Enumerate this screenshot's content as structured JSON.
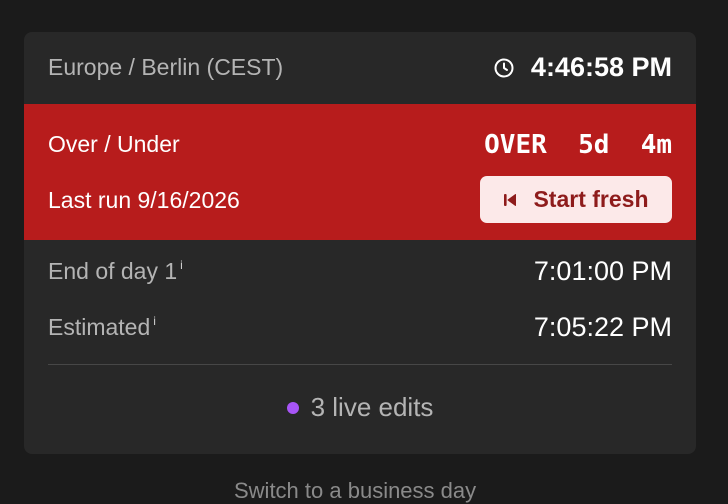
{
  "header": {
    "timezone": "Europe / Berlin (CEST)",
    "current_time": "4:46:58 PM",
    "clock_icon": "clock-icon"
  },
  "status": {
    "label": "Over / Under",
    "value": "OVER  5d  4m",
    "last_run": "Last run 9/16/2026",
    "start_button_label": "Start fresh",
    "start_button_icon": "skip-back-icon",
    "panel_color": "#b71c1c"
  },
  "rows": [
    {
      "label": "End of day 1",
      "info": "i",
      "value": "7:01:00 PM"
    },
    {
      "label": "Estimated",
      "info": "i",
      "value": "7:05:22 PM"
    }
  ],
  "footer": {
    "live_text": "3 live edits",
    "dot_color": "#a855f7"
  },
  "below_text": "Switch to a business day"
}
